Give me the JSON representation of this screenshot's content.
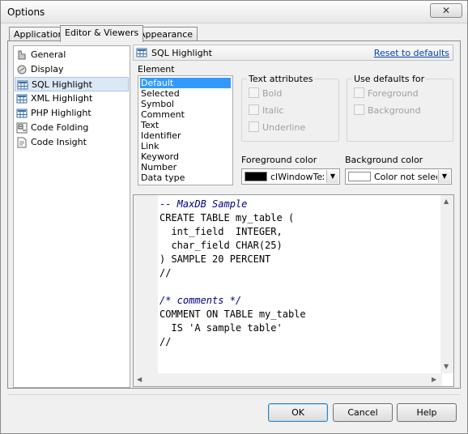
{
  "window": {
    "title": "Options",
    "close_label": "✕"
  },
  "tabs": [
    {
      "label": "Application",
      "active": false
    },
    {
      "label": "Editor & Viewers",
      "active": true
    },
    {
      "label": "Appearance",
      "active": false
    }
  ],
  "sidebar": {
    "items": [
      {
        "label": "General",
        "icon": "general-icon"
      },
      {
        "label": "Display",
        "icon": "display-icon"
      },
      {
        "label": "SQL Highlight",
        "icon": "grid-icon",
        "selected": true
      },
      {
        "label": "XML Highlight",
        "icon": "grid-icon"
      },
      {
        "label": "PHP Highlight",
        "icon": "grid-icon"
      },
      {
        "label": "Code Folding",
        "icon": "folding-icon"
      },
      {
        "label": "Code Insight",
        "icon": "insight-icon"
      }
    ]
  },
  "section": {
    "title": "SQL Highlight",
    "reset_label": "Reset to defaults"
  },
  "element": {
    "label": "Element",
    "items": [
      "Default",
      "Selected",
      "Symbol",
      "Comment",
      "Text",
      "Identifier",
      "Link",
      "Keyword",
      "Number",
      "Data type"
    ],
    "selected": "Default"
  },
  "text_attributes": {
    "label": "Text attributes",
    "options": [
      "Bold",
      "Italic",
      "Underline"
    ]
  },
  "use_defaults": {
    "label": "Use defaults for",
    "options": [
      "Foreground",
      "Background"
    ]
  },
  "foreground": {
    "label": "Foreground color",
    "value": "clWindowText",
    "swatch": "#000000"
  },
  "background": {
    "label": "Background color",
    "value": "Color not selected",
    "swatch": "#ffffff"
  },
  "code_lines": [
    {
      "text": "-- MaxDB Sample",
      "comment": true
    },
    {
      "text": "CREATE TABLE my_table (",
      "comment": false
    },
    {
      "text": "  int_field  INTEGER,",
      "comment": false
    },
    {
      "text": "  char_field CHAR(25)",
      "comment": false
    },
    {
      "text": ") SAMPLE 20 PERCENT",
      "comment": false
    },
    {
      "text": "//",
      "comment": false
    },
    {
      "text": "",
      "comment": false
    },
    {
      "text": "/* comments */",
      "comment": true
    },
    {
      "text": "COMMENT ON TABLE my_table",
      "comment": false
    },
    {
      "text": "  IS 'A sample table'",
      "comment": false
    },
    {
      "text": "//",
      "comment": false
    }
  ],
  "buttons": {
    "ok": "OK",
    "cancel": "Cancel",
    "help": "Help"
  }
}
